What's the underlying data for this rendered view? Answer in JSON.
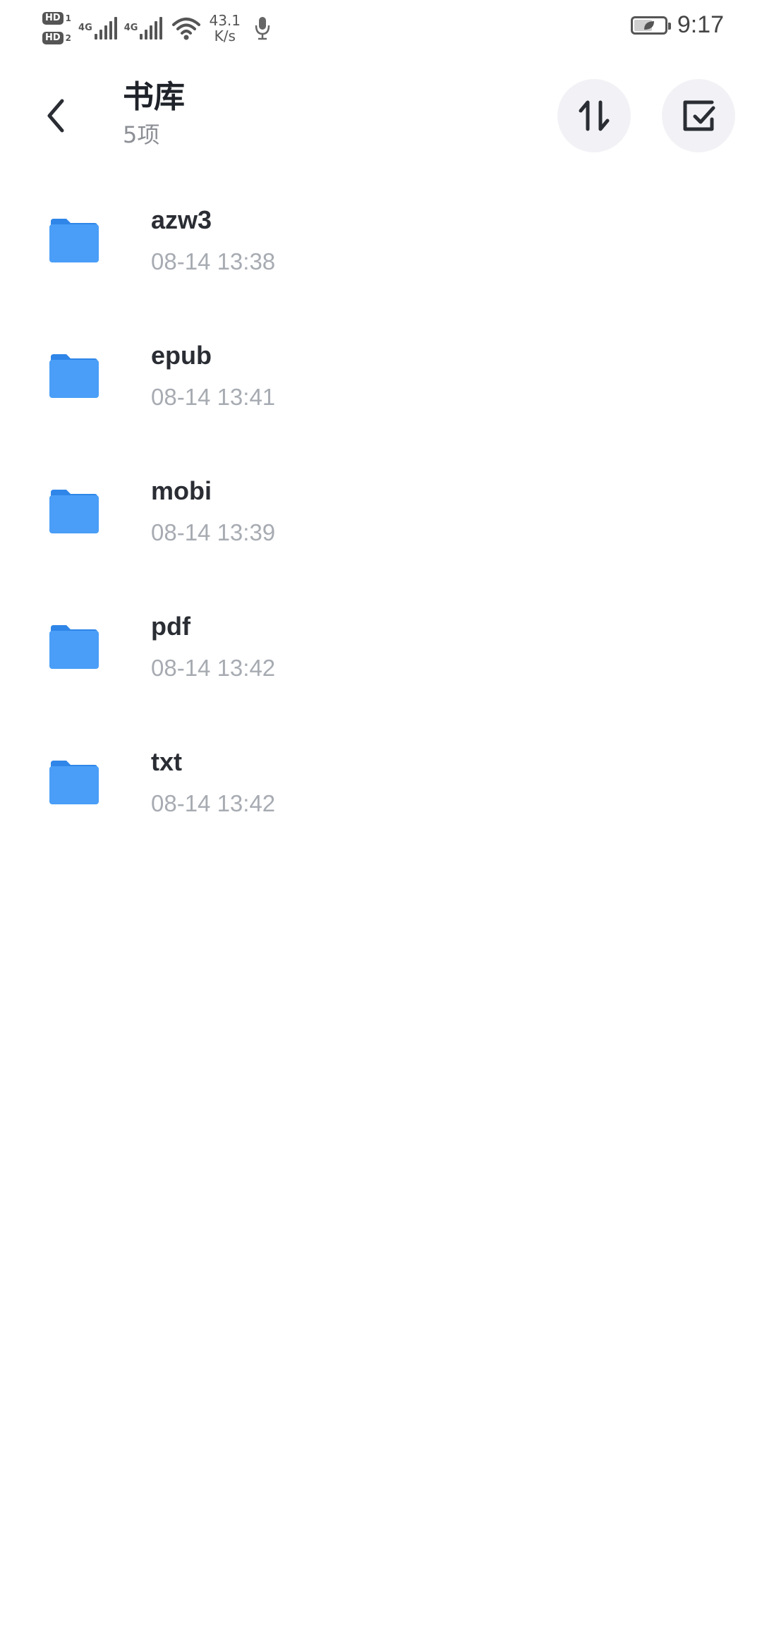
{
  "status_bar": {
    "sim1_label": "HD",
    "sim1_num": "1",
    "sim2_label": "HD",
    "sim2_num": "2",
    "network1": "4G",
    "network2": "4G",
    "speed_value": "43.1",
    "speed_unit": "K/s",
    "battery_level": 0.6,
    "time": "9:17"
  },
  "header": {
    "title": "书库",
    "count": "5项"
  },
  "files": [
    {
      "name": "azw3",
      "date": "08-14 13:38"
    },
    {
      "name": "epub",
      "date": "08-14 13:41"
    },
    {
      "name": "mobi",
      "date": "08-14 13:39"
    },
    {
      "name": "pdf",
      "date": "08-14 13:42"
    },
    {
      "name": "txt",
      "date": "08-14 13:42"
    }
  ],
  "colors": {
    "folder": "#4a9ef7",
    "folder_tab": "#2f86e8",
    "title": "#1f2329",
    "secondary": "#a7abb2",
    "button_bg": "#f2f2f6"
  },
  "icons": {
    "back": "chevron-left-icon",
    "sort": "sort-arrows-icon",
    "select": "select-checkbox-icon",
    "folder": "folder-icon"
  }
}
